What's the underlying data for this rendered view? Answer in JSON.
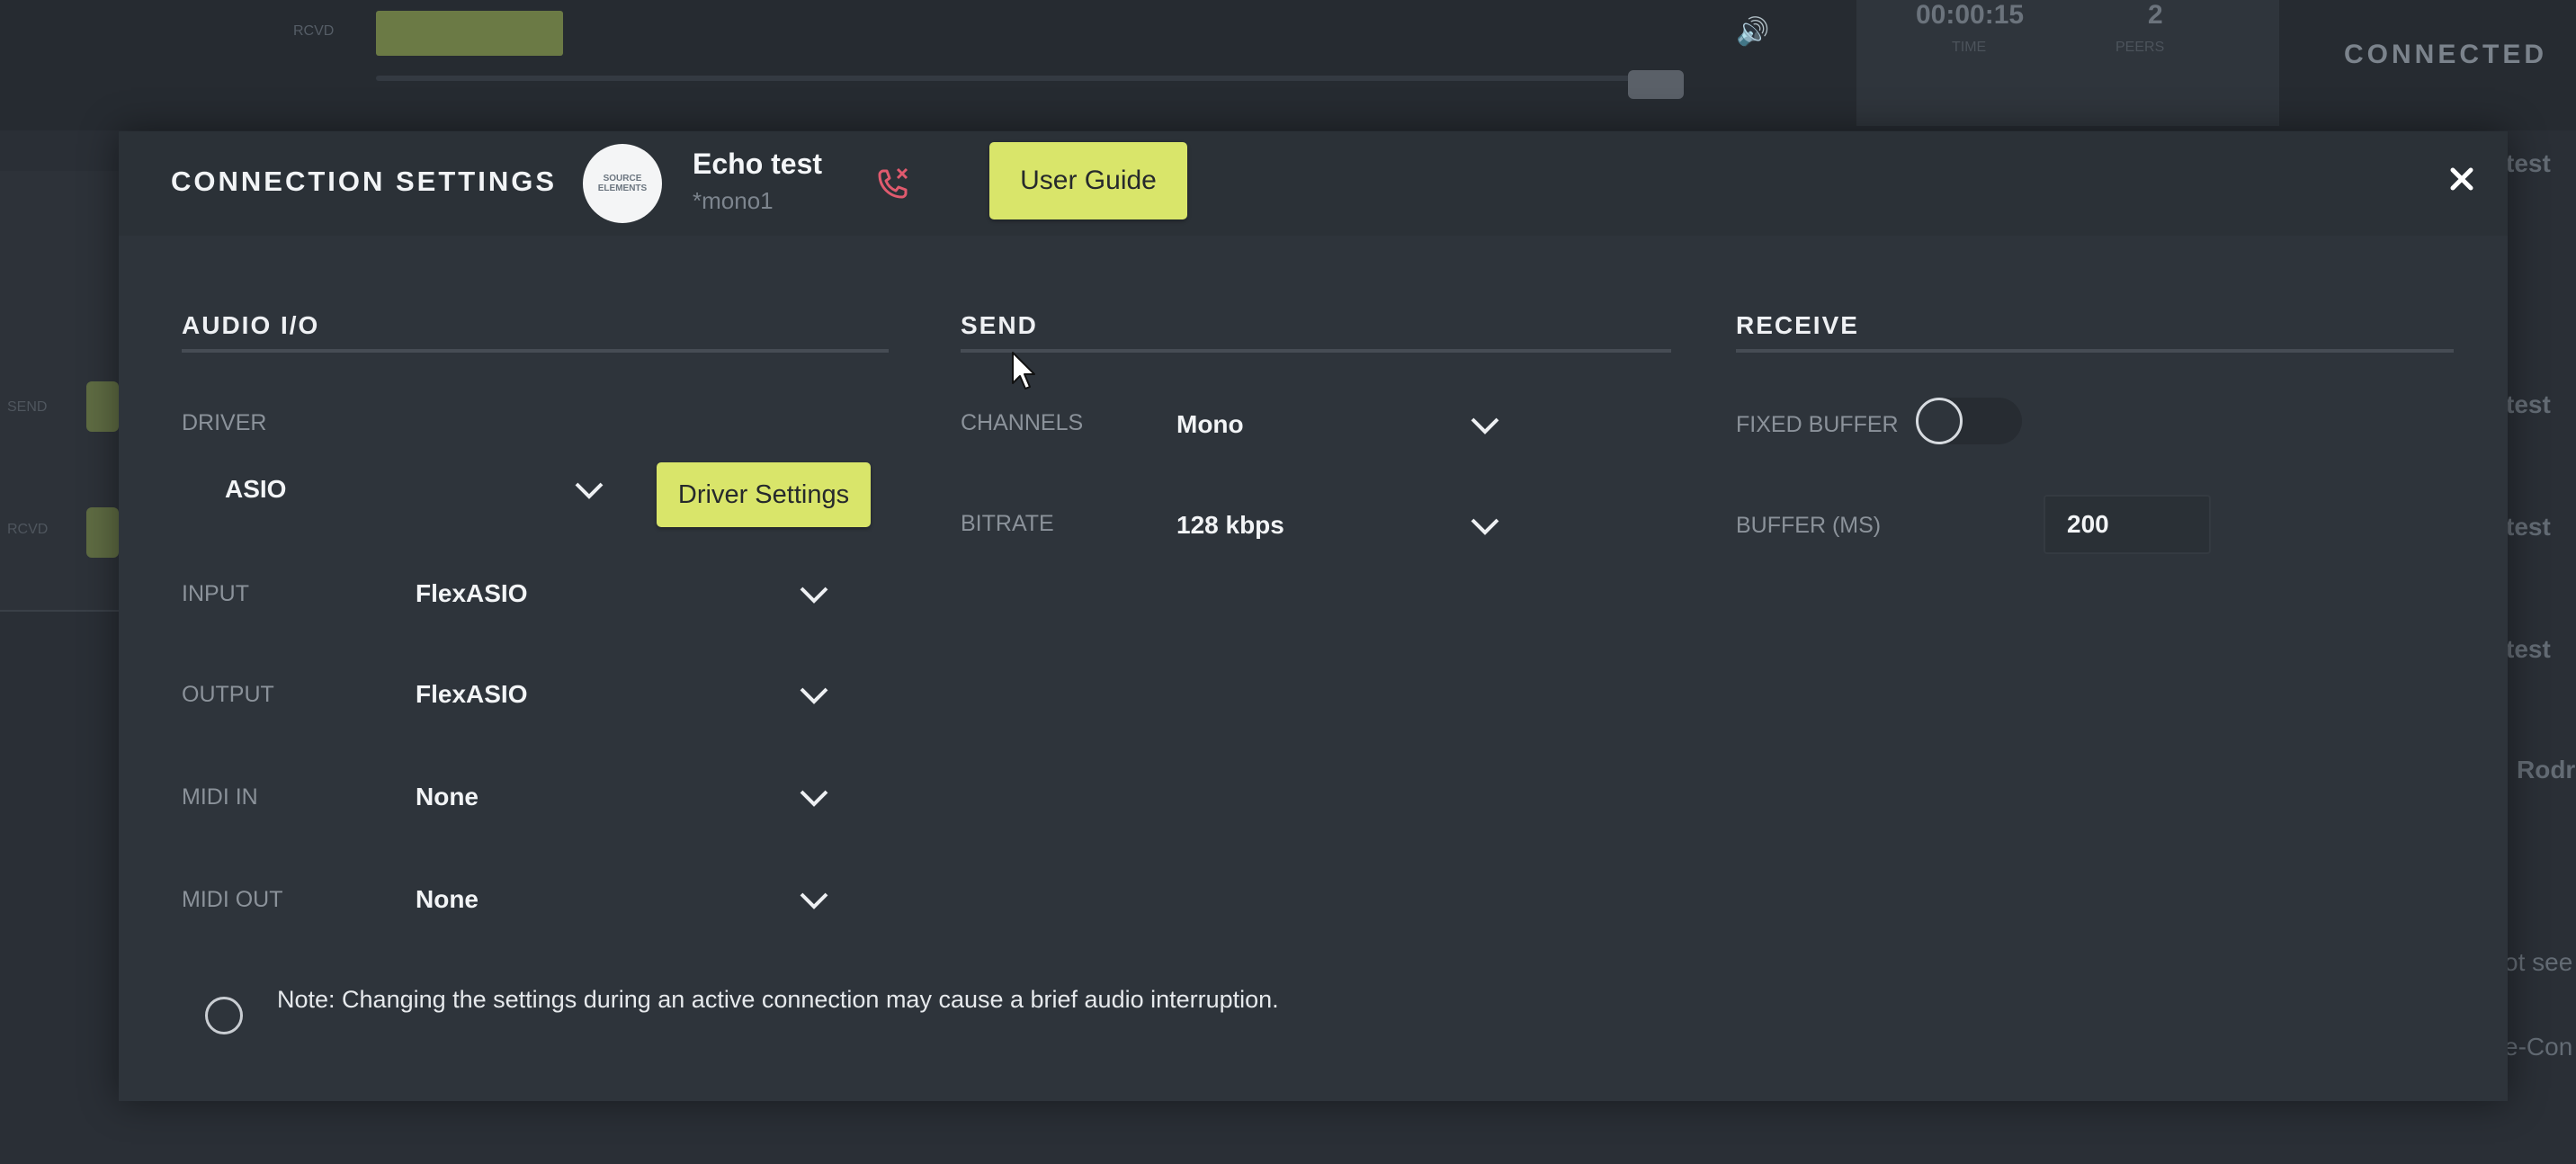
{
  "background": {
    "meter_label": "RCVD",
    "timer": "00:00:15",
    "timer_label": "TIME",
    "count": "2",
    "count_label": "PEERS",
    "status": "CONNECTED",
    "left_send_label": "SEND",
    "left_receive_label": "RCVD",
    "right_items": [
      "test",
      "test",
      "test",
      "test",
      "Rodr",
      "ot see",
      "e-Con"
    ]
  },
  "dialog": {
    "title": "CONNECTION SETTINGS",
    "logo_text": "SOURCE ELEMENTS",
    "connection_name": "Echo test",
    "connection_sub": "*mono1",
    "user_guide_label": "User Guide",
    "close_icon": "close-icon",
    "hangup_icon": "hangup-call-icon"
  },
  "audio_io": {
    "title": "AUDIO I/O",
    "driver_label": "DRIVER",
    "driver_value": "ASIO",
    "driver_settings_label": "Driver Settings",
    "input_label": "INPUT",
    "input_value": "FlexASIO",
    "output_label": "OUTPUT",
    "output_value": "FlexASIO",
    "midi_in_label": "MIDI IN",
    "midi_in_value": "None",
    "midi_out_label": "MIDI OUT",
    "midi_out_value": "None"
  },
  "send": {
    "title": "SEND",
    "channels_label": "CHANNELS",
    "channels_value": "Mono",
    "bitrate_label": "BITRATE",
    "bitrate_value": "128 kbps"
  },
  "receive": {
    "title": "RECEIVE",
    "fixed_buffer_label": "FIXED BUFFER",
    "fixed_buffer_on": false,
    "buffer_label": "BUFFER (MS)",
    "buffer_value": "200"
  },
  "note": "Note: Changing the settings during an active connection may cause a brief audio interruption.",
  "colors": {
    "accent": "#d9e56a",
    "dialog_bg": "#2e343b",
    "page_bg": "#2a2f36",
    "hangup": "#e05a6e"
  }
}
